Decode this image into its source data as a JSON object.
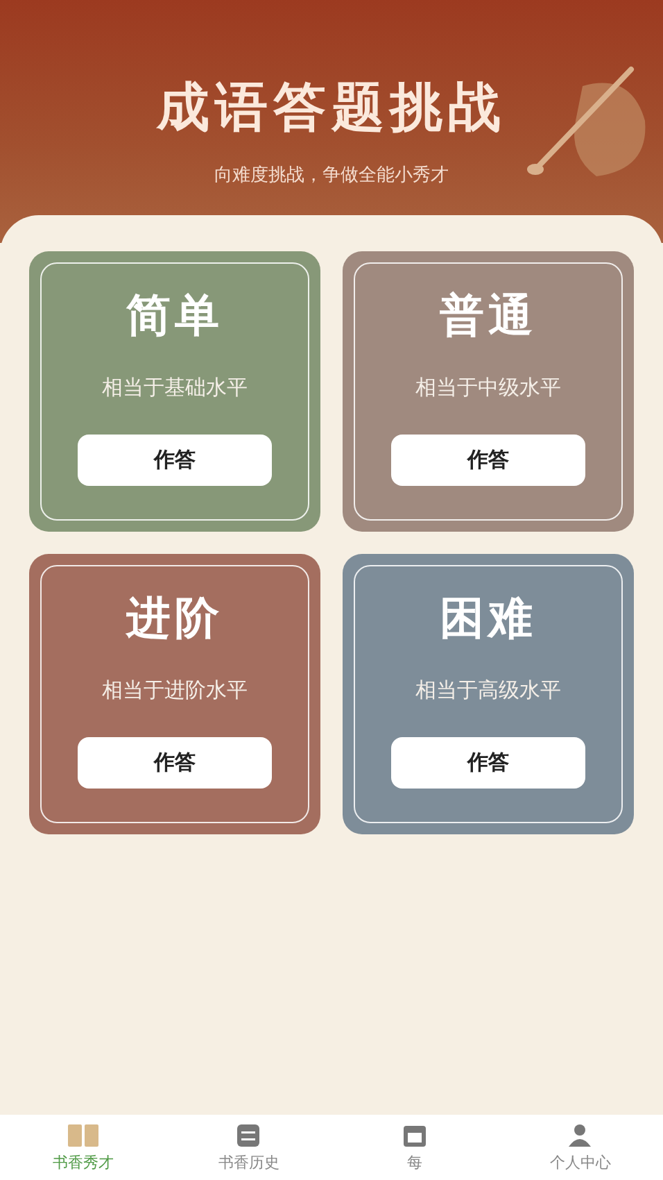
{
  "header": {
    "title": "成语答题挑战",
    "subtitle": "向难度挑战，争做全能小秀才"
  },
  "levels": [
    {
      "name": "简单",
      "description": "相当于基础水平",
      "button": "作答",
      "color": "#879878"
    },
    {
      "name": "普通",
      "description": "相当于中级水平",
      "button": "作答",
      "color": "#a08a7f"
    },
    {
      "name": "进阶",
      "description": "相当于进阶水平",
      "button": "作答",
      "color": "#a46e5f"
    },
    {
      "name": "困难",
      "description": "相当于高级水平",
      "button": "作答",
      "color": "#7e8d99"
    }
  ],
  "tabs": [
    {
      "label": "书香秀才",
      "kind": "book",
      "selected": true
    },
    {
      "label": "书香历史",
      "kind": "note",
      "selected": false
    },
    {
      "label": "每",
      "kind": "calendar",
      "selected": false
    },
    {
      "label": "个人中心",
      "kind": "person",
      "selected": false
    }
  ]
}
